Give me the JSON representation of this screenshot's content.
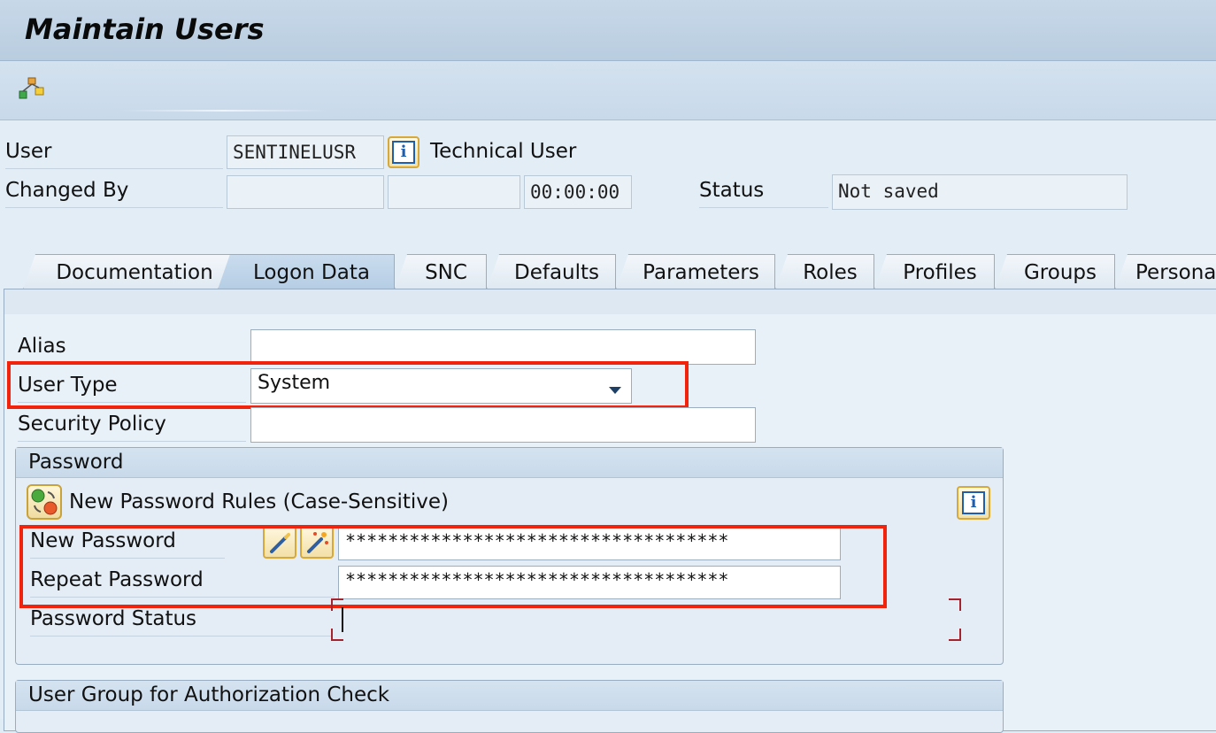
{
  "app": {
    "title": "Maintain Users"
  },
  "header": {
    "user_label": "User",
    "user_value": "SENTINELUSR",
    "user_desc": "Technical User",
    "changed_by_label": "Changed By",
    "changed_by_value": "",
    "changed_date_value": "",
    "changed_time_value": "00:00:00",
    "status_label": "Status",
    "status_value": "Not saved"
  },
  "tabs": [
    {
      "label": "Documentation"
    },
    {
      "label": "Logon Data"
    },
    {
      "label": "SNC"
    },
    {
      "label": "Defaults"
    },
    {
      "label": "Parameters"
    },
    {
      "label": "Roles"
    },
    {
      "label": "Profiles"
    },
    {
      "label": "Groups"
    },
    {
      "label": "Personali"
    }
  ],
  "active_tab": "Logon Data",
  "logon": {
    "alias_label": "Alias",
    "alias_value": "",
    "user_type_label": "User Type",
    "user_type_value": "System",
    "security_policy_label": "Security Policy",
    "security_policy_value": ""
  },
  "password_group": {
    "title": "Password",
    "rules_text": "New Password Rules (Case-Sensitive)",
    "new_password_label": "New Password",
    "new_password_value": "************************************",
    "repeat_password_label": "Repeat Password",
    "repeat_password_value": "************************************",
    "password_status_label": "Password Status"
  },
  "auth_group": {
    "title": "User Group for Authorization Check"
  },
  "colors": {
    "highlight": "#f2230c",
    "accent": "#1d5fae"
  },
  "icons": [
    "hierarchy-icon",
    "info-icon",
    "dropdown-arrow-icon",
    "rules-icon",
    "wand-icon",
    "wand-sparkle-icon"
  ]
}
